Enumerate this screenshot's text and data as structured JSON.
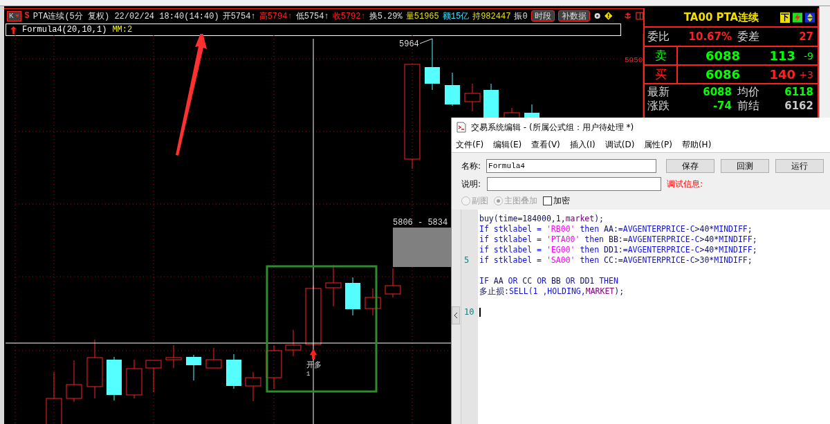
{
  "chart_header": {
    "period_button": "K",
    "symbol": "$",
    "title": "PTA连续(5分 复权) 22/02/24 18:40(14:40)",
    "quotes": [
      {
        "text": "开5754↑",
        "color": "#e0e0e0"
      },
      {
        "text": "高5794↑",
        "color": "#ff2020"
      },
      {
        "text": "低5754↑",
        "color": "#e0e0e0"
      },
      {
        "text": "收5792↑",
        "color": "#ff2020"
      },
      {
        "text": "换5.29%",
        "color": "#e0e0e0"
      },
      {
        "text": "量51965",
        "color": "#e8e000"
      },
      {
        "text": "额15亿",
        "color": "#40e0ff"
      },
      {
        "text": "持982447",
        "color": "#e8e000"
      },
      {
        "text": "振0",
        "color": "#e0e0e0"
      }
    ],
    "buttons": [
      "时段",
      "补数据"
    ]
  },
  "formula_bar": {
    "name": "Formula4(20,10,1)",
    "output": "MM:2"
  },
  "chart": {
    "high_label": "5964",
    "zone_label": "5806 - 5834",
    "signal_label": "开多",
    "signal_qty": "1",
    "axis_label": "5950"
  },
  "quote_panel": {
    "title": "TA00 PTA连续",
    "badge": "下",
    "ratio": [
      {
        "label": "委比",
        "value": "10.67%"
      },
      {
        "label": "委差",
        "value": "27"
      }
    ],
    "orders": [
      {
        "kind": "sell",
        "side": "卖",
        "price": "6088",
        "volume": "113",
        "change": "-9"
      },
      {
        "kind": "buy",
        "side": "买",
        "price": "6086",
        "volume": "140",
        "change": "+3"
      }
    ],
    "stats": [
      {
        "label": "最新",
        "value": "6088",
        "color": "#00ff00"
      },
      {
        "label": "均价",
        "value": "6118",
        "color": "#00ff00"
      },
      {
        "label": "涨跌",
        "value": "-74",
        "color": "#00ff00"
      },
      {
        "label": "前结",
        "value": "6162",
        "color": "#c8c8c8"
      }
    ]
  },
  "dialog": {
    "title": "交易系统编辑 - (所属公式组：用户待处理 *)",
    "menu": [
      "文件(F)",
      "编辑(E)",
      "查看(V)",
      "插入(I)",
      "调试(D)",
      "属性(P)",
      "帮助(H)"
    ],
    "name_label": "名称:",
    "name_value": "Formula4",
    "desc_label": "说明:",
    "buttons": [
      "保存",
      "回测",
      "运行"
    ],
    "debug_label": "调试信息:",
    "options": [
      {
        "kind": "radio",
        "label": "副图",
        "selected": false,
        "disabled": true
      },
      {
        "kind": "radio",
        "label": "主图叠加",
        "selected": true,
        "disabled": true
      },
      {
        "kind": "checkbox",
        "label": "加密",
        "checked": false,
        "disabled": false
      }
    ],
    "code": [
      {
        "caret": false,
        "tokens": [
          {
            "text": "buy(time=184000,1,",
            "kind": "text"
          },
          {
            "text": "market",
            "kind": "const"
          },
          {
            "text": ");",
            "kind": "text"
          }
        ]
      },
      {
        "caret": false,
        "tokens": [
          {
            "text": "If stklabel = ",
            "kind": "kw"
          },
          {
            "text": "'RB00'",
            "kind": "str"
          },
          {
            "text": " then",
            "kind": "kw"
          },
          {
            "text": " AA:=",
            "kind": "text"
          },
          {
            "text": "AVGENTERPRICE-C",
            "kind": "kw"
          },
          {
            "text": ">40*",
            "kind": "text"
          },
          {
            "text": "MINDIFF",
            "kind": "kw"
          },
          {
            "text": ";",
            "kind": "text"
          }
        ]
      },
      {
        "caret": false,
        "tokens": [
          {
            "text": "if stklabel = ",
            "kind": "kw"
          },
          {
            "text": "'PTA00'",
            "kind": "str"
          },
          {
            "text": " then",
            "kind": "kw"
          },
          {
            "text": " BB:=",
            "kind": "text"
          },
          {
            "text": "AVGENTERPRICE-C",
            "kind": "kw"
          },
          {
            "text": ">40*",
            "kind": "text"
          },
          {
            "text": "MINDIFF",
            "kind": "kw"
          },
          {
            "text": ";",
            "kind": "text"
          }
        ]
      },
      {
        "caret": false,
        "tokens": [
          {
            "text": "if stklabel = ",
            "kind": "kw"
          },
          {
            "text": "'EG00'",
            "kind": "str"
          },
          {
            "text": " then",
            "kind": "kw"
          },
          {
            "text": " DD1:=",
            "kind": "text"
          },
          {
            "text": "AVGENTERPRICE-C",
            "kind": "kw"
          },
          {
            "text": ">40*",
            "kind": "text"
          },
          {
            "text": "MINDIFF",
            "kind": "kw"
          },
          {
            "text": ";",
            "kind": "text"
          }
        ]
      },
      {
        "number": "5",
        "caret": false,
        "tokens": [
          {
            "text": "if stklabel = ",
            "kind": "kw"
          },
          {
            "text": "'SA00'",
            "kind": "str"
          },
          {
            "text": " then",
            "kind": "kw"
          },
          {
            "text": " CC:=",
            "kind": "text"
          },
          {
            "text": "AVGENTERPRICE-C",
            "kind": "kw"
          },
          {
            "text": ">30*",
            "kind": "text"
          },
          {
            "text": "MINDIFF",
            "kind": "kw"
          },
          {
            "text": ";",
            "kind": "text"
          }
        ]
      },
      {
        "caret": false
      },
      {
        "caret": false,
        "tokens": [
          {
            "text": "IF",
            "kind": "kw"
          },
          {
            "text": " AA ",
            "kind": "text"
          },
          {
            "text": "OR",
            "kind": "kw"
          },
          {
            "text": " CC ",
            "kind": "text"
          },
          {
            "text": "OR",
            "kind": "kw"
          },
          {
            "text": " BB ",
            "kind": "text"
          },
          {
            "text": "OR",
            "kind": "kw"
          },
          {
            "text": " DD1 ",
            "kind": "text"
          },
          {
            "text": "THEN",
            "kind": "kw"
          }
        ]
      },
      {
        "caret": false,
        "tokens": [
          {
            "text": "多止损:",
            "kind": "text"
          },
          {
            "text": "SELL(1 ,HOLDING,",
            "kind": "kw"
          },
          {
            "text": "MARKET",
            "kind": "const"
          },
          {
            "text": ");",
            "kind": "text"
          }
        ]
      },
      {
        "caret": false
      },
      {
        "number": "10",
        "caret": true
      }
    ]
  }
}
